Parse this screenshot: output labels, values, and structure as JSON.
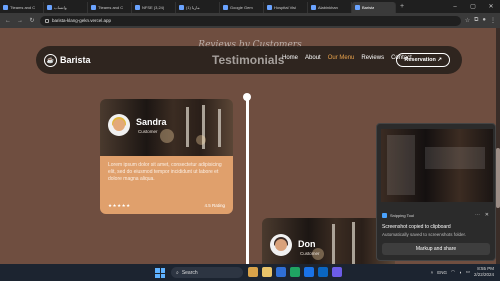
{
  "browser": {
    "tabs": [
      {
        "label": "Tteams and C",
        "active": false
      },
      {
        "label": "واتساب",
        "active": false
      },
      {
        "label": "Tteams and C",
        "active": false
      },
      {
        "label": "NFSE (3,24)",
        "active": false
      },
      {
        "label": "(1) ماريا",
        "active": false
      },
      {
        "label": "Google Gem",
        "active": false
      },
      {
        "label": "Hospital Visi",
        "active": false
      },
      {
        "label": "Alabinkhan",
        "active": false
      },
      {
        "label": "Barista",
        "active": true
      }
    ],
    "new_tab": "+",
    "url": "barista-klang-gekn.vercel.app"
  },
  "site": {
    "logo_name": "Barista",
    "subtitle": "Reviews by Customers",
    "title": "Testimonials",
    "menu": [
      "Home",
      "About",
      "Our Menu",
      "Reviews",
      "Contact"
    ],
    "active_menu": "Our Menu",
    "reservation": "Reservation ↗"
  },
  "testimonials": [
    {
      "name": "Sandra",
      "role": "Customer",
      "text": "Lorem ipsum dolor sit amet, consectetur adipisicing elit, sed do eiusmod tempor incididunt ut labore et dolore magna aliqua.",
      "stars": "★★★★★",
      "rating": "4.5 Rating"
    },
    {
      "name": "Don",
      "role": "Customer"
    }
  ],
  "snipping_tool": {
    "app": "Snipping Tool",
    "message": "Screenshot copied to clipboard",
    "detail": "Automatically saved to screenshots folder.",
    "button": "Markup and share"
  },
  "taskbar": {
    "search_placeholder": "Search",
    "lang": "ENG",
    "time": "8:55 PM",
    "date": "2/22/2024"
  },
  "colors": {
    "page_bg": "#6f4e40",
    "card_body": "#e0a06c",
    "accent": "#e8a24c"
  }
}
